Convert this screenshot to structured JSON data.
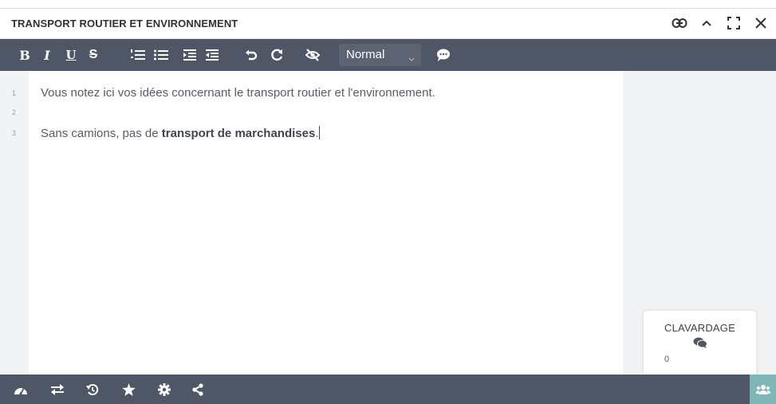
{
  "window": {
    "title": "TRANSPORT ROUTIER ET ENVIRONNEMENT",
    "actions": [
      "link-icon",
      "chevron-up-icon",
      "fullscreen-icon",
      "close-icon"
    ]
  },
  "toolbar": {
    "bold_label": "B",
    "italic_label": "I",
    "underline_label": "U",
    "strike_label": "S",
    "style_select_value": "Normal"
  },
  "editor": {
    "line_numbers": [
      "1",
      "2",
      "3"
    ],
    "line1": "Vous notez ici vos idées concernant le transport routier et l'environnement.",
    "line3_plain": "Sans camions, pas de ",
    "line3_bold": "transport de marchandises",
    "line3_end": "."
  },
  "chat": {
    "title": "CLAVARDAGE",
    "count": "0"
  },
  "colors": {
    "toolbar_bg": "#4f5767",
    "side_bg": "#f1f2f4",
    "users_button_bg": "#7fb6b7"
  }
}
